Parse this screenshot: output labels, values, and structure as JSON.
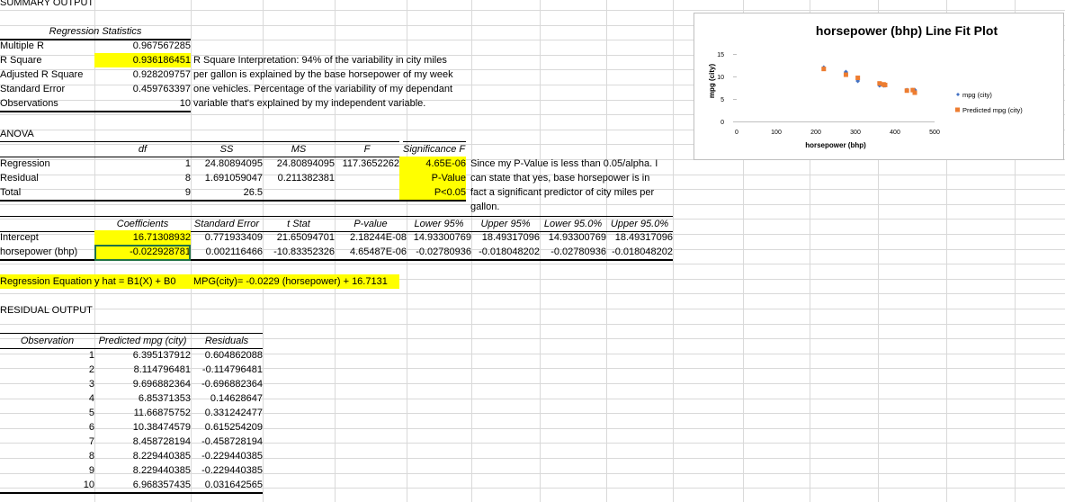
{
  "sheet": {
    "summary_title": "SUMMARY OUTPUT",
    "regression_stats_header": "Regression Statistics",
    "stats": [
      {
        "label": "Multiple R",
        "value": "0.967567285"
      },
      {
        "label": "R Square",
        "value": "0.936186451"
      },
      {
        "label": "Adjusted R Square",
        "value": "0.928209757"
      },
      {
        "label": "Standard Error",
        "value": "0.459763397"
      },
      {
        "label": "Observations",
        "value": "10"
      }
    ],
    "r_square_note": [
      "R Square Interpretation: 94% of the variability in city miles",
      "per gallon is explained by the base horsepower of my week",
      "one vehicles. Percentage of the variability of my dependant",
      "variable that's explained by my independent variable."
    ],
    "anova_title": "ANOVA",
    "anova_headers": [
      "df",
      "SS",
      "MS",
      "F",
      "Significance F"
    ],
    "anova_rows": [
      {
        "label": "Regression",
        "df": "1",
        "ss": "24.80894095",
        "ms": "24.80894095",
        "f": "117.3652262",
        "sig": "4.65E-06"
      },
      {
        "label": "Residual",
        "df": "8",
        "ss": "1.691059047",
        "ms": "0.211382381",
        "f": "",
        "sig": "P-Value"
      },
      {
        "label": "Total",
        "df": "9",
        "ss": "26.5",
        "ms": "",
        "f": "",
        "sig": "P<0.05"
      }
    ],
    "pvalue_note": [
      "Since my P-Value is less than 0.05/alpha. I",
      "can state that yes, base horsepower is in",
      "fact a significant predictor of city miles per",
      "gallon."
    ],
    "coef_headers": [
      "Coefficients",
      "Standard Error",
      "t Stat",
      "P-value",
      "Lower 95%",
      "Upper 95%",
      "Lower 95.0%",
      "Upper 95.0%"
    ],
    "coef_rows": [
      {
        "label": "Intercept",
        "vals": [
          "16.71308932",
          "0.771933409",
          "21.65094701",
          "2.18244E-08",
          "14.93300769",
          "18.49317096",
          "14.93300769",
          "18.49317096"
        ]
      },
      {
        "label": "horsepower (bhp)",
        "vals": [
          "-0.022928781",
          "0.002116466",
          "-10.83352326",
          "4.65487E-06",
          "-0.02780936",
          "-0.018048202",
          "-0.02780936",
          "-0.018048202"
        ]
      }
    ],
    "equation_label": "Regression Equation",
    "equation_general": "y hat = B1(X) + B0",
    "equation_specific": "MPG(city)= -0.0229 (horsepower) + 16.7131",
    "residual_title": "RESIDUAL OUTPUT",
    "residual_headers": [
      "Observation",
      "Predicted mpg (city)",
      "Residuals"
    ],
    "residual_rows": [
      {
        "obs": "1",
        "pred": "6.395137912",
        "res": "0.604862088"
      },
      {
        "obs": "2",
        "pred": "8.114796481",
        "res": "-0.114796481"
      },
      {
        "obs": "3",
        "pred": "9.696882364",
        "res": "-0.696882364"
      },
      {
        "obs": "4",
        "pred": "6.85371353",
        "res": "0.14628647"
      },
      {
        "obs": "5",
        "pred": "11.66875752",
        "res": "0.331242477"
      },
      {
        "obs": "6",
        "pred": "10.38474579",
        "res": "0.615254209"
      },
      {
        "obs": "7",
        "pred": "8.458728194",
        "res": "-0.458728194"
      },
      {
        "obs": "8",
        "pred": "8.229440385",
        "res": "-0.229440385"
      },
      {
        "obs": "9",
        "pred": "8.229440385",
        "res": "-0.229440385"
      },
      {
        "obs": "10",
        "pred": "6.968357435",
        "res": "0.031642565"
      }
    ]
  },
  "colors": {
    "highlight": "#ffff00",
    "series_actual": "#4472c4",
    "series_predicted": "#ed7d31"
  },
  "chart_data": {
    "type": "scatter",
    "title": "horsepower (bhp) Line Fit  Plot",
    "xlabel": "horsepower (bhp)",
    "ylabel": "mpg (city)",
    "xlim": [
      0,
      500
    ],
    "ylim": [
      0,
      15
    ],
    "xticks": [
      "0",
      "100",
      "200",
      "300",
      "400",
      "500"
    ],
    "yticks": [
      "0",
      "5",
      "10",
      "15"
    ],
    "legend_position": "right",
    "series": [
      {
        "name": "mpg (city)",
        "marker": "diamond",
        "x": [
          450,
          375,
          306,
          430,
          220,
          276,
          361,
          371,
          371,
          445
        ],
        "y": [
          7,
          8,
          9,
          7,
          12,
          11,
          8,
          8,
          8,
          7
        ]
      },
      {
        "name": "Predicted mpg (city)",
        "marker": "square",
        "x": [
          450,
          375,
          306,
          430,
          220,
          276,
          361,
          371,
          371,
          445
        ],
        "y": [
          6.395137912,
          8.114796481,
          9.696882364,
          6.85371353,
          11.66875752,
          10.38474579,
          8.458728194,
          8.229440385,
          8.229440385,
          6.968357435
        ]
      }
    ]
  }
}
